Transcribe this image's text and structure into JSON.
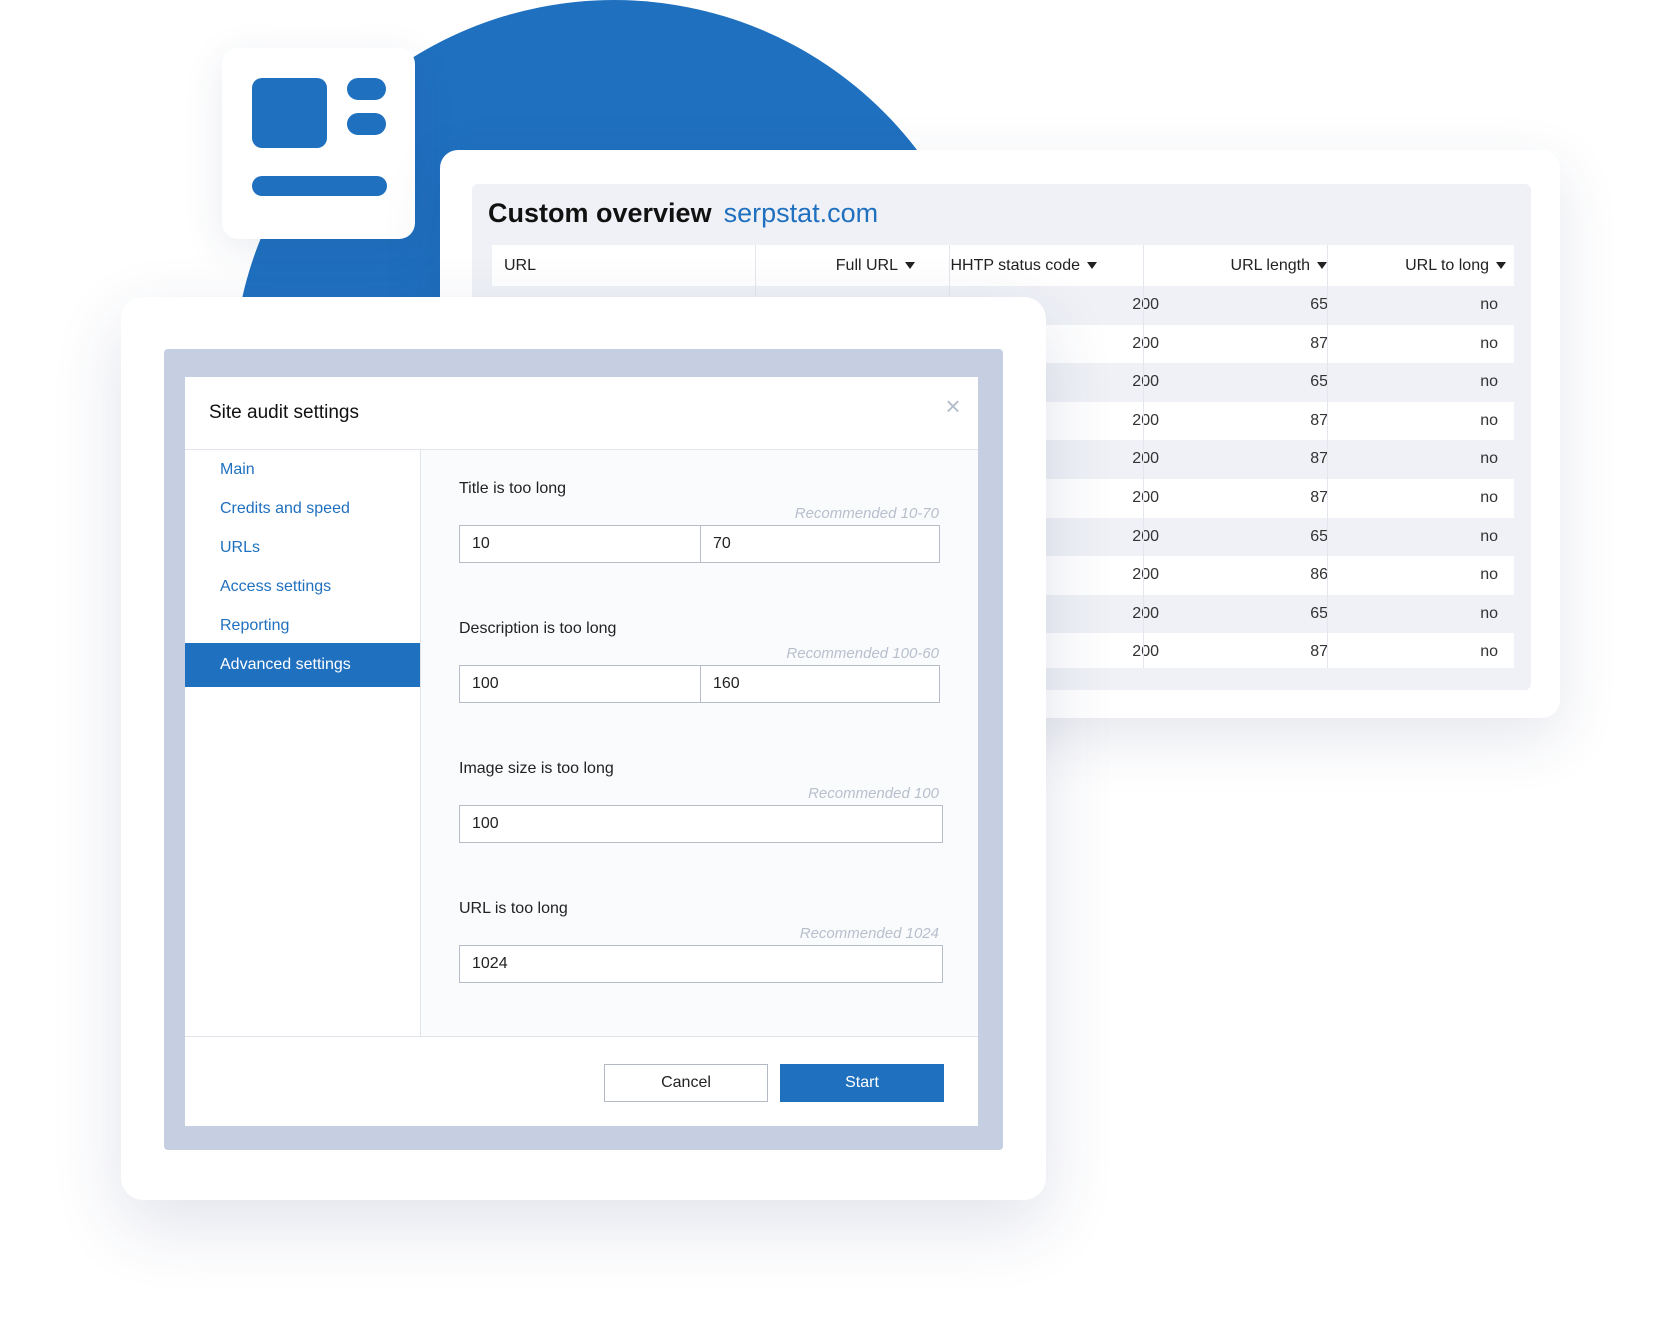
{
  "overview": {
    "title": "Custom overview",
    "domain": "serpstat.com",
    "columns": [
      "URL",
      "Full URL",
      "HHTP status code",
      "URL length",
      "URL to long"
    ],
    "rows": [
      {
        "status": "200",
        "length": "65",
        "too_long": "no"
      },
      {
        "status": "200",
        "length": "87",
        "too_long": "no"
      },
      {
        "status": "200",
        "length": "65",
        "too_long": "no"
      },
      {
        "status": "200",
        "length": "87",
        "too_long": "no"
      },
      {
        "status": "200",
        "length": "87",
        "too_long": "no"
      },
      {
        "status": "200",
        "length": "87",
        "too_long": "no"
      },
      {
        "status": "200",
        "length": "65",
        "too_long": "no"
      },
      {
        "status": "200",
        "length": "86",
        "too_long": "no"
      },
      {
        "status": "200",
        "length": "65",
        "too_long": "no"
      },
      {
        "status": "200",
        "length": "87",
        "too_long": "no"
      }
    ]
  },
  "modal": {
    "title": "Site audit settings",
    "close_icon": "close-icon",
    "nav": [
      "Main",
      "Credits and speed",
      "URLs",
      "Access settings",
      "Reporting",
      "Advanced settings"
    ],
    "active_nav": "Advanced settings",
    "fields": {
      "title": {
        "label": "Title is too long",
        "recommended": "Recommended 10-70",
        "min": "10",
        "max": "70"
      },
      "description": {
        "label": "Description is too long",
        "recommended": "Recommended 100-60",
        "min": "100",
        "max": "160"
      },
      "image": {
        "label": "Image size is too long",
        "recommended": "Recommended 100",
        "value": "100"
      },
      "url": {
        "label": "URL is too long",
        "recommended": "Recommended 1024",
        "value": "1024"
      }
    },
    "cancel_label": "Cancel",
    "start_label": "Start"
  },
  "colors": {
    "accent": "#1f70bf",
    "frame": "#c6cfe1",
    "row_alt": "#eff1f6"
  }
}
